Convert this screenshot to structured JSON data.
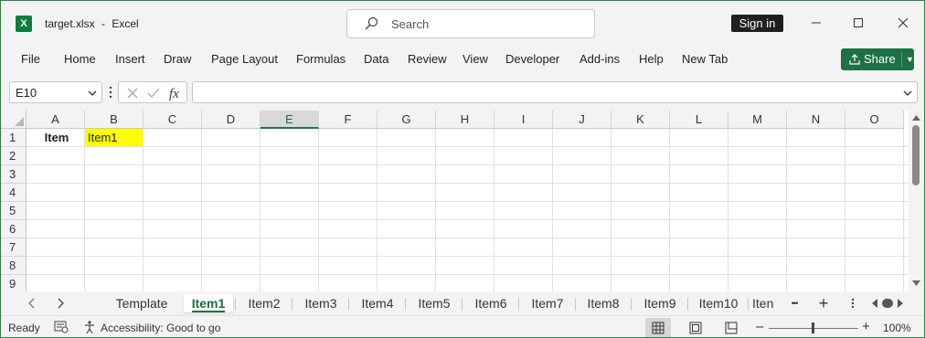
{
  "window": {
    "file_name": "target.xlsx",
    "separator": "-",
    "app_name": "Excel",
    "search_placeholder": "Search",
    "sign_in_label": "Sign in"
  },
  "ribbon": {
    "tabs": [
      "File",
      "Home",
      "Insert",
      "Draw",
      "Page Layout",
      "Formulas",
      "Data",
      "Review",
      "View",
      "Developer",
      "Add-ins",
      "Help",
      "New Tab"
    ],
    "share_label": "Share"
  },
  "formula_bar": {
    "name_box": "E10",
    "formula": ""
  },
  "grid": {
    "columns": [
      "A",
      "B",
      "C",
      "D",
      "E",
      "F",
      "G",
      "H",
      "I",
      "J",
      "K",
      "L",
      "M",
      "N",
      "O"
    ],
    "rows": [
      "1",
      "2",
      "3",
      "4",
      "5",
      "6",
      "7",
      "8",
      "9"
    ],
    "selected_column": "E",
    "cells": {
      "A1": "Item",
      "B1": "Item1"
    },
    "highlight_color": "#ffff00"
  },
  "sheets": {
    "tabs": [
      "Template",
      "Item1",
      "Item2",
      "Item3",
      "Item4",
      "Item5",
      "Item6",
      "Item7",
      "Item8",
      "Item9",
      "Item10",
      "Iten"
    ],
    "active": "Item1",
    "more_label": "•••",
    "add_label": "+"
  },
  "status": {
    "ready": "Ready",
    "accessibility": "Accessibility: Good to go",
    "zoom": "100%",
    "zoom_level_percent": 100
  },
  "colors": {
    "accent": "#217346",
    "share_bg": "#1e7145"
  }
}
